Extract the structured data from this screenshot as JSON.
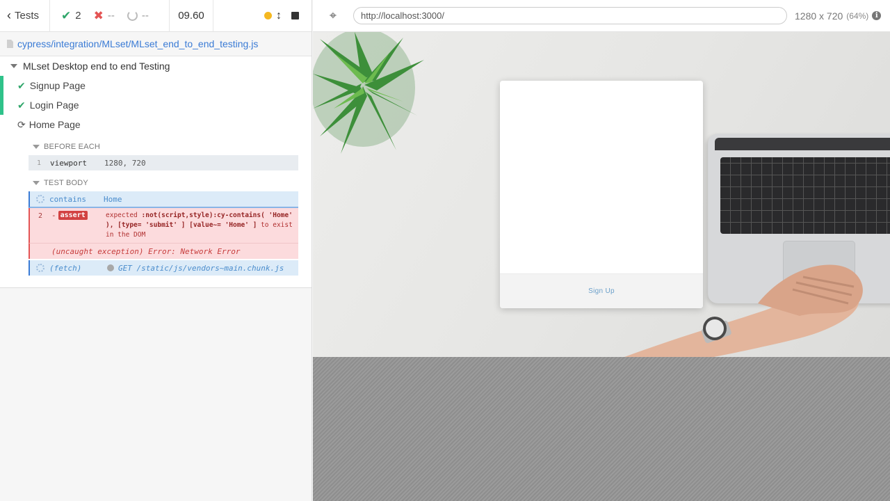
{
  "stats": {
    "tests_label": "Tests",
    "passed": "2",
    "failed": "--",
    "pending": "--",
    "duration": "09.60",
    "colors": {
      "passed": "#2fa66a",
      "failed": "#e45454",
      "running_dot": "#f5b820"
    }
  },
  "spec": {
    "path": "cypress/integration/MLset/MLset_end_to_end_testing.js"
  },
  "suite": {
    "title": "MLset Desktop end to end Testing",
    "tests": [
      {
        "title": "Signup Page",
        "state": "passed"
      },
      {
        "title": "Login Page",
        "state": "passed"
      },
      {
        "title": "Home Page",
        "state": "running"
      }
    ]
  },
  "hooks": {
    "before_each": {
      "title": "BEFORE EACH",
      "commands": [
        {
          "number": "1",
          "name": "viewport",
          "message": "1280, 720"
        }
      ]
    },
    "test_body": {
      "title": "TEST BODY",
      "contains": {
        "name": "contains",
        "message": "Home"
      },
      "assert": {
        "number": "2",
        "prefix": "-",
        "name": "assert",
        "message_1": "expected",
        "message_2": ":not(script,style):cy-contains( 'Home' ), [type= 'submit' ] [value~= 'Home' ]",
        "message_3": "to exist in the DOM"
      },
      "error": {
        "message": "(uncaught exception) Error: Network Error"
      },
      "fetch": {
        "name": "(fetch)",
        "message": "GET /static/js/vendors~main.chunk.js"
      }
    }
  },
  "aut": {
    "url": "http://localhost:3000/",
    "viewport": "1280 x 720",
    "scale": "(64%)",
    "info_icon": "i",
    "signup_link": "Sign Up"
  }
}
